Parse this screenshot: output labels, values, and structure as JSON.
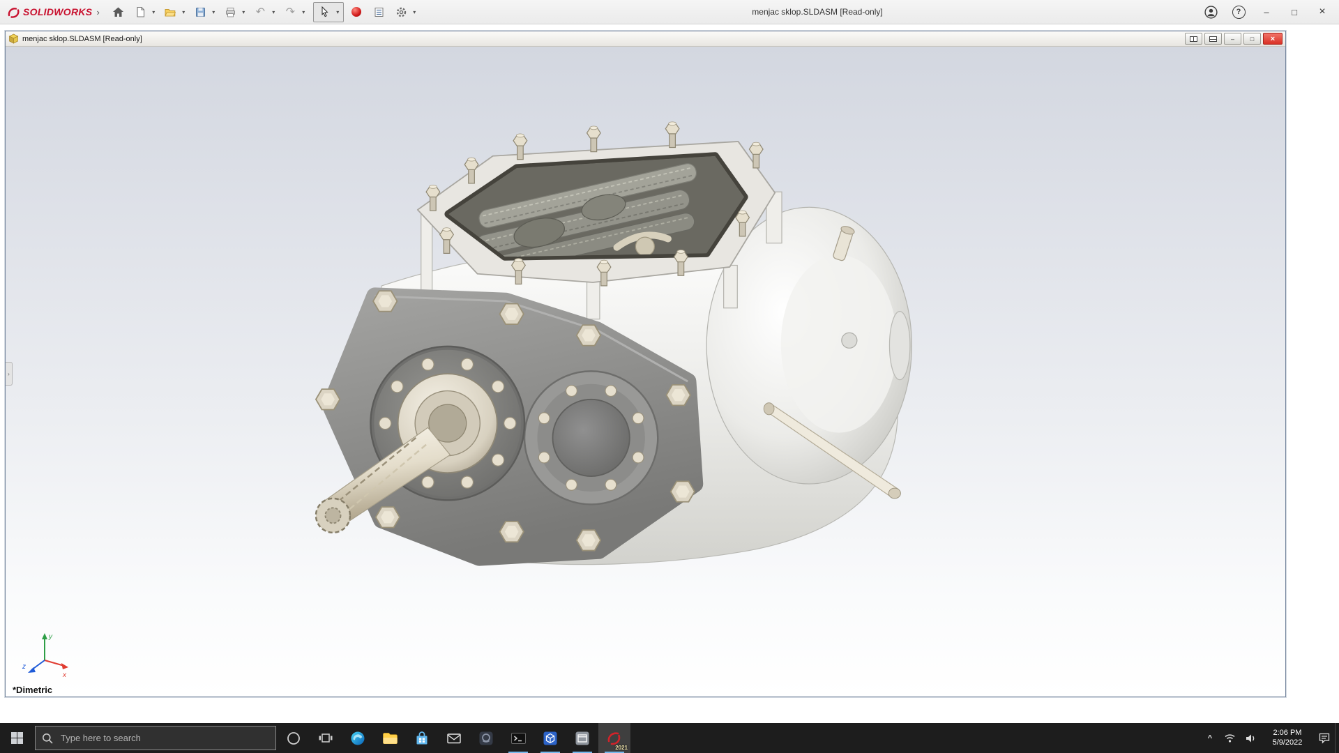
{
  "app": {
    "logo_text": "SOLIDWORKS",
    "window_title": "menjac sklop.SLDASM [Read-only]"
  },
  "glyphs": {
    "logo_chevron": "›",
    "dropdown": "▾",
    "undo": "↶",
    "redo": "↷",
    "minimize": "–",
    "maximize": "□",
    "close": "×",
    "help": "?",
    "tray_chevron": "^",
    "flyout_chevron": "›"
  },
  "toolbar": {
    "buttons": [
      "home",
      "new-document",
      "open",
      "save",
      "print",
      "undo",
      "redo",
      "select",
      "red-sphere",
      "file-properties",
      "options"
    ]
  },
  "doc": {
    "title": "menjac sklop.SLDASM [Read-only]",
    "view_orientation": "*Dimetric",
    "triad": {
      "x": "x",
      "y": "y",
      "z": "z"
    }
  },
  "taskbar": {
    "search_placeholder": "Type here to search",
    "pinned_apps": [
      "cortana",
      "task-view",
      "edge",
      "file-explorer",
      "store",
      "mail",
      "app-dark",
      "terminal",
      "cube-app",
      "window-app",
      "solidworks"
    ],
    "solidworks_version_badge": "2021",
    "clock": {
      "time": "2:06 PM",
      "date": "5/9/2022"
    }
  },
  "icon_names": [
    "solidworks-logo-icon",
    "home-icon",
    "new-document-icon",
    "open-folder-icon",
    "save-icon",
    "print-icon",
    "undo-icon",
    "redo-icon",
    "select-cursor-icon",
    "red-sphere-icon",
    "file-properties-icon",
    "gear-icon",
    "account-icon",
    "help-icon",
    "assembly-icon",
    "search-icon",
    "windows-start-icon",
    "cortana-icon",
    "task-view-icon",
    "edge-icon",
    "file-explorer-icon",
    "store-icon",
    "mail-icon",
    "terminal-icon",
    "wifi-icon",
    "speaker-icon",
    "action-center-icon",
    "triad-icon"
  ],
  "colors": {
    "solidworks_red": "#c8102e",
    "close_button_red": "#d93025",
    "taskbar_background": "#1d1d1d",
    "running_indicator_blue": "#76b9ed",
    "viewport_gradient_top": "#d3d7e0",
    "viewport_gradient_bottom": "#ffffff",
    "triad_x_red": "#e03c31",
    "triad_y_green": "#2e9e46",
    "triad_z_blue": "#1f5bd8"
  }
}
